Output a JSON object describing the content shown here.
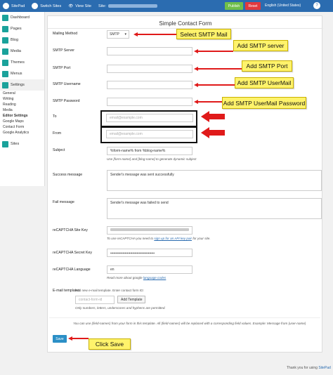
{
  "topbar": {
    "brand": "SitePad",
    "switch": "Switch Sites",
    "view": "View Site",
    "site_label": "Site:",
    "publish": "Publish",
    "reset": "Reset",
    "language": "English (United States)",
    "help": "?"
  },
  "sidebar": {
    "items": [
      {
        "label": "Dashboard"
      },
      {
        "label": "Pages"
      },
      {
        "label": "Blog"
      },
      {
        "label": "Media"
      },
      {
        "label": "Themes"
      },
      {
        "label": "Menus"
      },
      {
        "label": "Settings"
      }
    ],
    "sub_items": [
      {
        "label": "General"
      },
      {
        "label": "Writing"
      },
      {
        "label": "Reading"
      },
      {
        "label": "Media"
      },
      {
        "label": "Editor Settings"
      },
      {
        "label": "Google Maps"
      },
      {
        "label": "Contact Form"
      },
      {
        "label": "Google Analytics"
      }
    ],
    "sites": "Sites"
  },
  "panel": {
    "title": "Simple Contact Form",
    "mailing_method_label": "Mailing Method",
    "mailing_method_value": "SMTP",
    "smtp_server_label": "SMTP Server",
    "smtp_port_label": "SMTP Port",
    "smtp_username_label": "SMTP Username",
    "smtp_password_label": "SMTP Password",
    "to_label": "To",
    "to_placeholder": "email@example.com",
    "from_label": "From",
    "from_placeholder": "email@example.com",
    "subject_label": "Subject",
    "subject_value": "%form-name% from %blog-name%",
    "subject_hint": "Use [form-name] and [blog-name] to generate dynamic subject",
    "success_label": "Success message",
    "success_value": "Sender's message was sent successfully",
    "fail_label": "Fail message",
    "fail_value": "Sender's message was failed to send",
    "recaptcha_site_label": "reCAPTCHA Site Key",
    "recaptcha_site_hint_pre": "To use reCAPTCHA you need to",
    "recaptcha_site_hint_link": "sign up for an API key pair",
    "recaptcha_site_hint_post": "for your site.",
    "recaptcha_secret_label": "reCAPTCHA Secret Key",
    "recaptcha_secret_value": "••••••••••••••••••••••••••••••••••••••••",
    "recaptcha_lang_label": "reCAPTCHA Language",
    "recaptcha_lang_value": "en",
    "recaptcha_lang_hint_pre": "Read more about google",
    "recaptcha_lang_hint_link": "language codes",
    "email_templates_label": "E-mail templates",
    "email_templates_intro": "Add new e-mail template. Enter contact form ID:",
    "email_templates_placeholder": "contact-form-id",
    "add_template": "Add Template",
    "email_templates_hint": "Only numbers, letters, underscores and hyphens are permitted.",
    "field_names_hint": "You can use {field-names} from your form in this template. All {field-names} will be replaced with a corresponding field values. Example: Message from {user-name}",
    "save": "Save"
  },
  "callouts": {
    "select_smtp": "Select SMTP Mail",
    "add_server": "Add SMTP server",
    "add_port": "Add SMTP Port",
    "add_usermail": "Add SMTP UserMail",
    "add_password": "Add SMTP UserMail Password",
    "click_save": "Click Save"
  },
  "footer": {
    "text": "Thank you for using",
    "link": "SitePad"
  },
  "colors": {
    "topbar": "#2b6cb0",
    "publish": "#6fbf4a",
    "reset": "#e0393e",
    "callout": "#fff36b",
    "arrow": "#e01a1a",
    "sidebar_icon": "#1aa29b"
  }
}
